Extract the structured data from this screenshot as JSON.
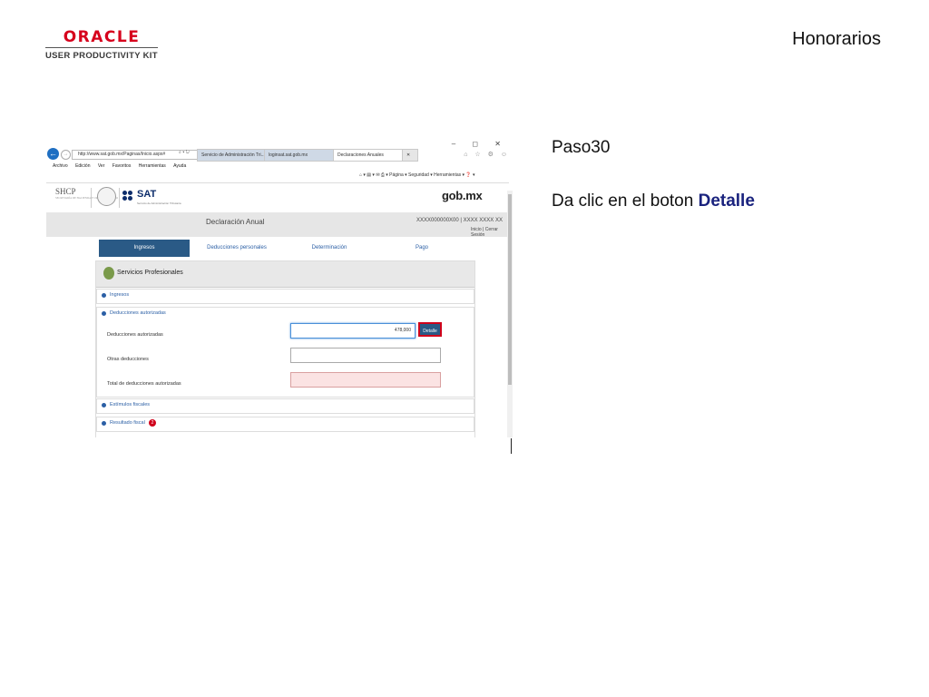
{
  "slide": {
    "oracle_word": "ORACLE",
    "oracle_sub": "USER PRODUCTIVITY KIT",
    "title": "Honorarios",
    "step": "Paso30",
    "instruction_prefix": "Da clic en el boton ",
    "instruction_target": "Detalle"
  },
  "browser": {
    "window_controls": "– ◻ ✕",
    "url": "http://www.sat.gob.mx/Paginas/Inicio.aspx#",
    "url_controls": "⌕ ▾ ↻",
    "tabs": [
      {
        "label": "Servicio de Administración Tri..."
      },
      {
        "label": "loginsat.sat.gob.mx"
      },
      {
        "label": "Declaraciones Anuales"
      },
      {
        "label": "✕"
      }
    ],
    "favs": "⌂ ☆ ⚙ ☺",
    "menu": [
      "Archivo",
      "Edición",
      "Ver",
      "Favoritos",
      "Herramientas",
      "Ayuda"
    ],
    "command_bar": "⌂ ▾ ▤ ▾ ✉ ⎙ ▾  Página ▾  Seguridad ▾  Herramientas ▾  ❓ ▾"
  },
  "page": {
    "shcp": "SHCP",
    "shcp_sub": "SECRETARÍA DE HACIENDA Y CRÉDITO PÚBLICO",
    "sat": "SAT",
    "sat_sub": "Servicio de Administración Tributaria",
    "gobmx": "gob.mx",
    "decl_title": "Declaración Anual",
    "rfc_line": "XXXX000000X00 | XXXX XXXX XX",
    "session_links": "Inicio | Cerrar Sesión",
    "nav_tabs": [
      "Ingresos",
      "Deducciones personales",
      "Determinación",
      "Pago"
    ],
    "panel_title": "Servicios Profesionales",
    "sections": {
      "ingresos": "Ingresos",
      "deducciones": "Deducciones autorizadas",
      "estimulos": "Estímulos fiscales",
      "resultado": "Resultado fiscal"
    },
    "fields": {
      "deducciones_label": "Deducciones autorizadas",
      "deducciones_value": "478,000",
      "otras_label": "Otras deducciones",
      "total_label": "Total de deducciones autorizadas"
    },
    "detalle_button": "Detalle",
    "resultado_badge": "2"
  }
}
